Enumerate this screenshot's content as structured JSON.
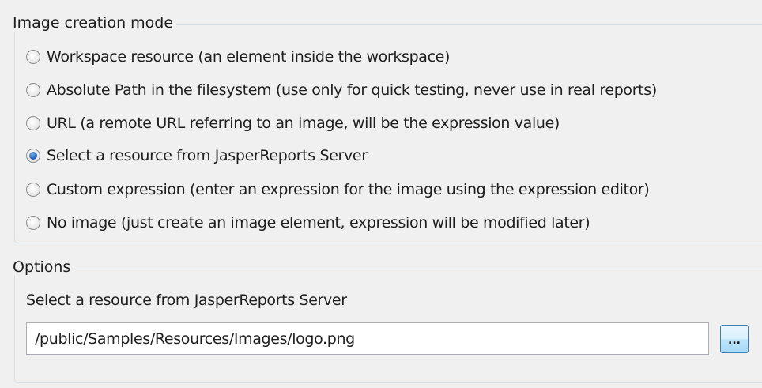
{
  "image_creation_mode": {
    "title": "Image creation mode",
    "options": [
      {
        "label": "Workspace resource (an element inside the workspace)",
        "selected": false
      },
      {
        "label": "Absolute Path in the filesystem (use only for quick testing, never use in real reports)",
        "selected": false
      },
      {
        "label": "URL (a remote URL referring to an image, will be the expression value)",
        "selected": false
      },
      {
        "label": "Select a resource from JasperReports Server",
        "selected": true
      },
      {
        "label": "Custom expression (enter an expression for the image using the expression editor)",
        "selected": false
      },
      {
        "label": "No image (just create an image element, expression will be modified later)",
        "selected": false
      }
    ]
  },
  "options": {
    "title": "Options",
    "resource_label": "Select a resource from JasperReports Server",
    "resource_path": "/public/Samples/Resources/Images/logo.png",
    "browse_label": "..."
  }
}
